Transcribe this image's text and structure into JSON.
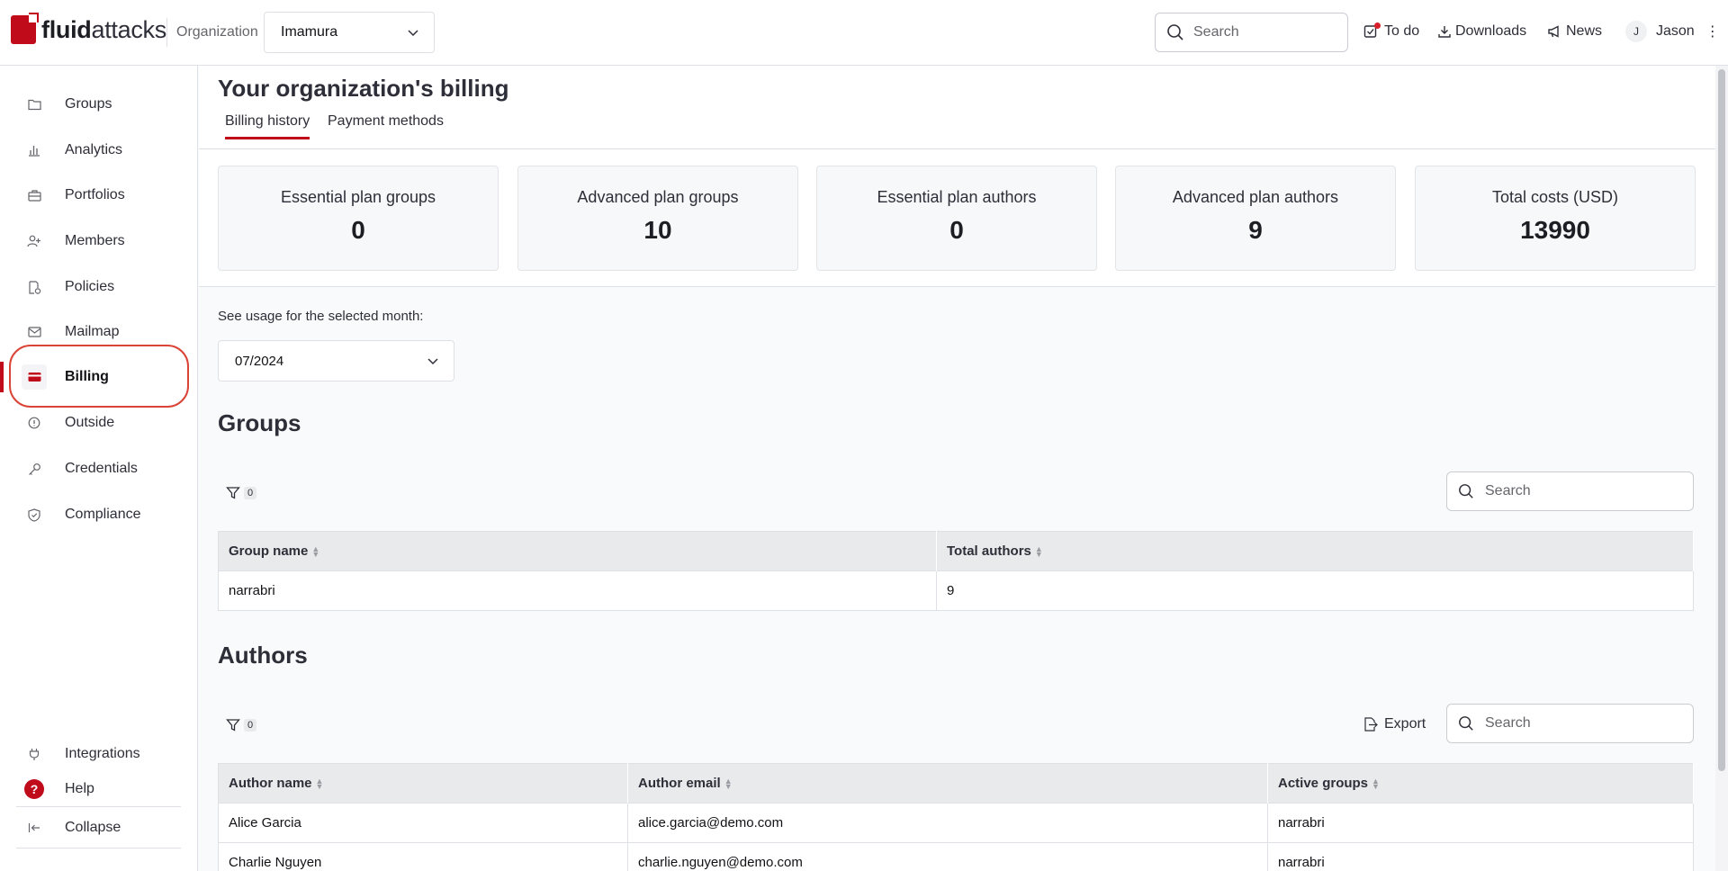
{
  "brand": {
    "name_bold": "fluid",
    "name_rest": "attacks"
  },
  "org": {
    "label": "Organization",
    "selected": "Imamura"
  },
  "topbar": {
    "search_placeholder": "Search",
    "todo": "To do",
    "downloads": "Downloads",
    "news": "News",
    "user_initial": "J",
    "user_name": "Jason"
  },
  "sidebar": {
    "items": [
      {
        "label": "Groups",
        "icon": "folder-icon"
      },
      {
        "label": "Analytics",
        "icon": "chart-icon"
      },
      {
        "label": "Portfolios",
        "icon": "briefcase-icon"
      },
      {
        "label": "Members",
        "icon": "user-plus-icon"
      },
      {
        "label": "Policies",
        "icon": "policy-icon"
      },
      {
        "label": "Mailmap",
        "icon": "mail-icon"
      },
      {
        "label": "Billing",
        "icon": "credit-card-icon",
        "active": true
      },
      {
        "label": "Outside",
        "icon": "info-icon"
      },
      {
        "label": "Credentials",
        "icon": "key-icon"
      },
      {
        "label": "Compliance",
        "icon": "shield-check-icon"
      }
    ],
    "bottom": {
      "integrations": "Integrations",
      "help": "Help",
      "help_icon": "?",
      "collapse": "Collapse"
    }
  },
  "page": {
    "title": "Your organization's billing",
    "tabs": [
      {
        "label": "Billing history",
        "active": true
      },
      {
        "label": "Payment methods"
      }
    ]
  },
  "stats": [
    {
      "label": "Essential plan groups",
      "value": "0"
    },
    {
      "label": "Advanced plan groups",
      "value": "10"
    },
    {
      "label": "Essential plan authors",
      "value": "0"
    },
    {
      "label": "Advanced plan authors",
      "value": "9"
    },
    {
      "label": "Total costs (USD)",
      "value": "13990"
    }
  ],
  "usage": {
    "label": "See usage for the selected month:",
    "month": "07/2024"
  },
  "groups": {
    "title": "Groups",
    "filter_count": "0",
    "search_placeholder": "Search",
    "columns": [
      "Group name",
      "Total authors"
    ],
    "rows": [
      [
        "narrabri",
        "9"
      ]
    ]
  },
  "authors": {
    "title": "Authors",
    "filter_count": "0",
    "export": "Export",
    "search_placeholder": "Search",
    "columns": [
      "Author name",
      "Author email",
      "Active groups"
    ],
    "rows": [
      [
        "Alice Garcia",
        "alice.garcia@demo.com",
        "narrabri"
      ],
      [
        "Charlie Nguyen",
        "charlie.nguyen@demo.com",
        "narrabri"
      ]
    ]
  }
}
